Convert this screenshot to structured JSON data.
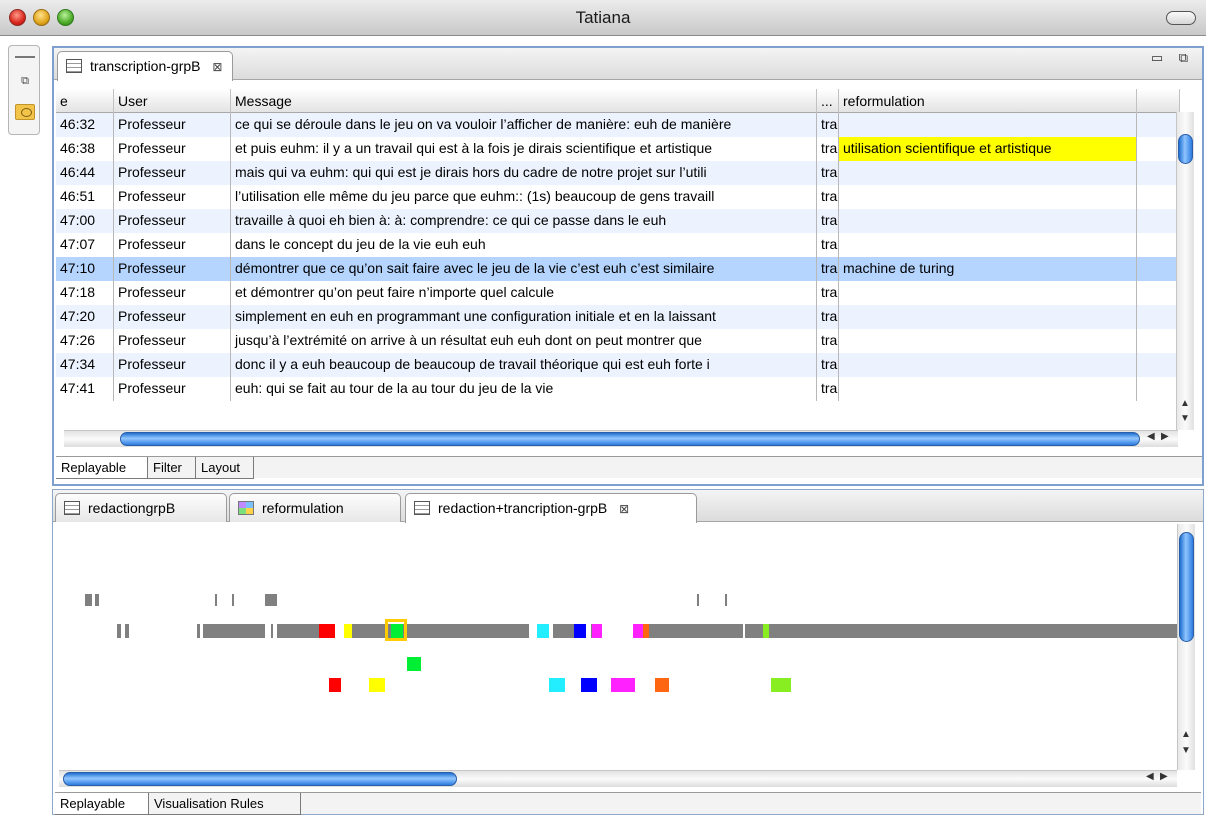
{
  "window": {
    "title": "Tatiana"
  },
  "top_panel": {
    "tab": {
      "label": "transcription-grpB",
      "close": "⊠"
    },
    "panel_controls": "▭ ⧉",
    "columns": [
      {
        "label": "e"
      },
      {
        "label": "User"
      },
      {
        "label": "Message"
      },
      {
        "label": "..."
      },
      {
        "label": "reformulation"
      }
    ],
    "rows": [
      {
        "time": "46:32",
        "user": "Professeur",
        "message": "ce qui se déroule dans le jeu on va vouloir l’afficher de manière: euh de manière",
        "trunc": "tra",
        "reform": ""
      },
      {
        "time": "46:38",
        "user": "Professeur",
        "message": "et puis euhm: il y a un travail qui est à la fois je dirais scientifique et artistique",
        "trunc": "tra",
        "reform": "utilisation scientifique et artistique"
      },
      {
        "time": "46:44",
        "user": "Professeur",
        "message": "mais qui va euhm: qui  qui est je dirais hors du cadre de notre projet sur l’utili",
        "trunc": "tra",
        "reform": ""
      },
      {
        "time": "46:51",
        "user": "Professeur",
        "message": "l’utilisation elle même du jeu parce que euhm:: (1s) beaucoup de gens travaill",
        "trunc": "tra",
        "reform": ""
      },
      {
        "time": "47:00",
        "user": "Professeur",
        "message": "travaille à quoi eh bien à: à: comprendre: ce qui ce passe dans le euh",
        "trunc": "tra",
        "reform": ""
      },
      {
        "time": "47:07",
        "user": "Professeur",
        "message": "dans le concept du jeu de la vie euh euh",
        "trunc": "tra",
        "reform": ""
      },
      {
        "time": "47:10",
        "user": "Professeur",
        "message": "démontrer que ce qu’on sait faire avec le jeu de la vie c’est euh c’est similaire",
        "trunc": "tra",
        "reform": "machine de turing"
      },
      {
        "time": "47:18",
        "user": "Professeur",
        "message": "et démontrer qu’on peut faire n’importe quel calcule",
        "trunc": "tra",
        "reform": ""
      },
      {
        "time": "47:20",
        "user": "Professeur",
        "message": "simplement en euh en programmant une configuration initiale et en la laissant",
        "trunc": "tra",
        "reform": ""
      },
      {
        "time": "47:26",
        "user": "Professeur",
        "message": "jusqu’à l’extrémité on arrive à un résultat euh euh dont on peut montrer que",
        "trunc": "tra",
        "reform": ""
      },
      {
        "time": "47:34",
        "user": "Professeur",
        "message": "donc il y a euh beaucoup de beaucoup de travail théorique qui est euh forte i",
        "trunc": "tra",
        "reform": ""
      },
      {
        "time": "47:41",
        "user": "Professeur",
        "message": "euh: qui se fait au tour de la au tour du jeu de la vie",
        "trunc": "tra",
        "reform": ""
      }
    ],
    "selected_row": 6,
    "highlight_color": "#ffff00",
    "selection_color": "#b5d5ff",
    "bottom_tabs": [
      "Replayable",
      "Filter",
      "Layout"
    ]
  },
  "bottom_panel": {
    "tabs": [
      {
        "label": "redactiongrpB",
        "icon": "table-icon"
      },
      {
        "label": "reformulation",
        "icon": "colorgrid-icon"
      },
      {
        "label": "redaction+trancription-grpB",
        "icon": "table-icon",
        "close": "⊠"
      }
    ],
    "bottom_tabs": [
      "Replayable",
      "Visualisation Rules"
    ],
    "colors": {
      "gray": "#808080",
      "red": "#ff0000",
      "yellow": "#ffff00",
      "green": "#00ee33",
      "cyan": "#22eeff",
      "blue": "#0000ff",
      "magenta": "#ff22ff",
      "orange": "#ff6611",
      "lime": "#88ee22"
    }
  }
}
